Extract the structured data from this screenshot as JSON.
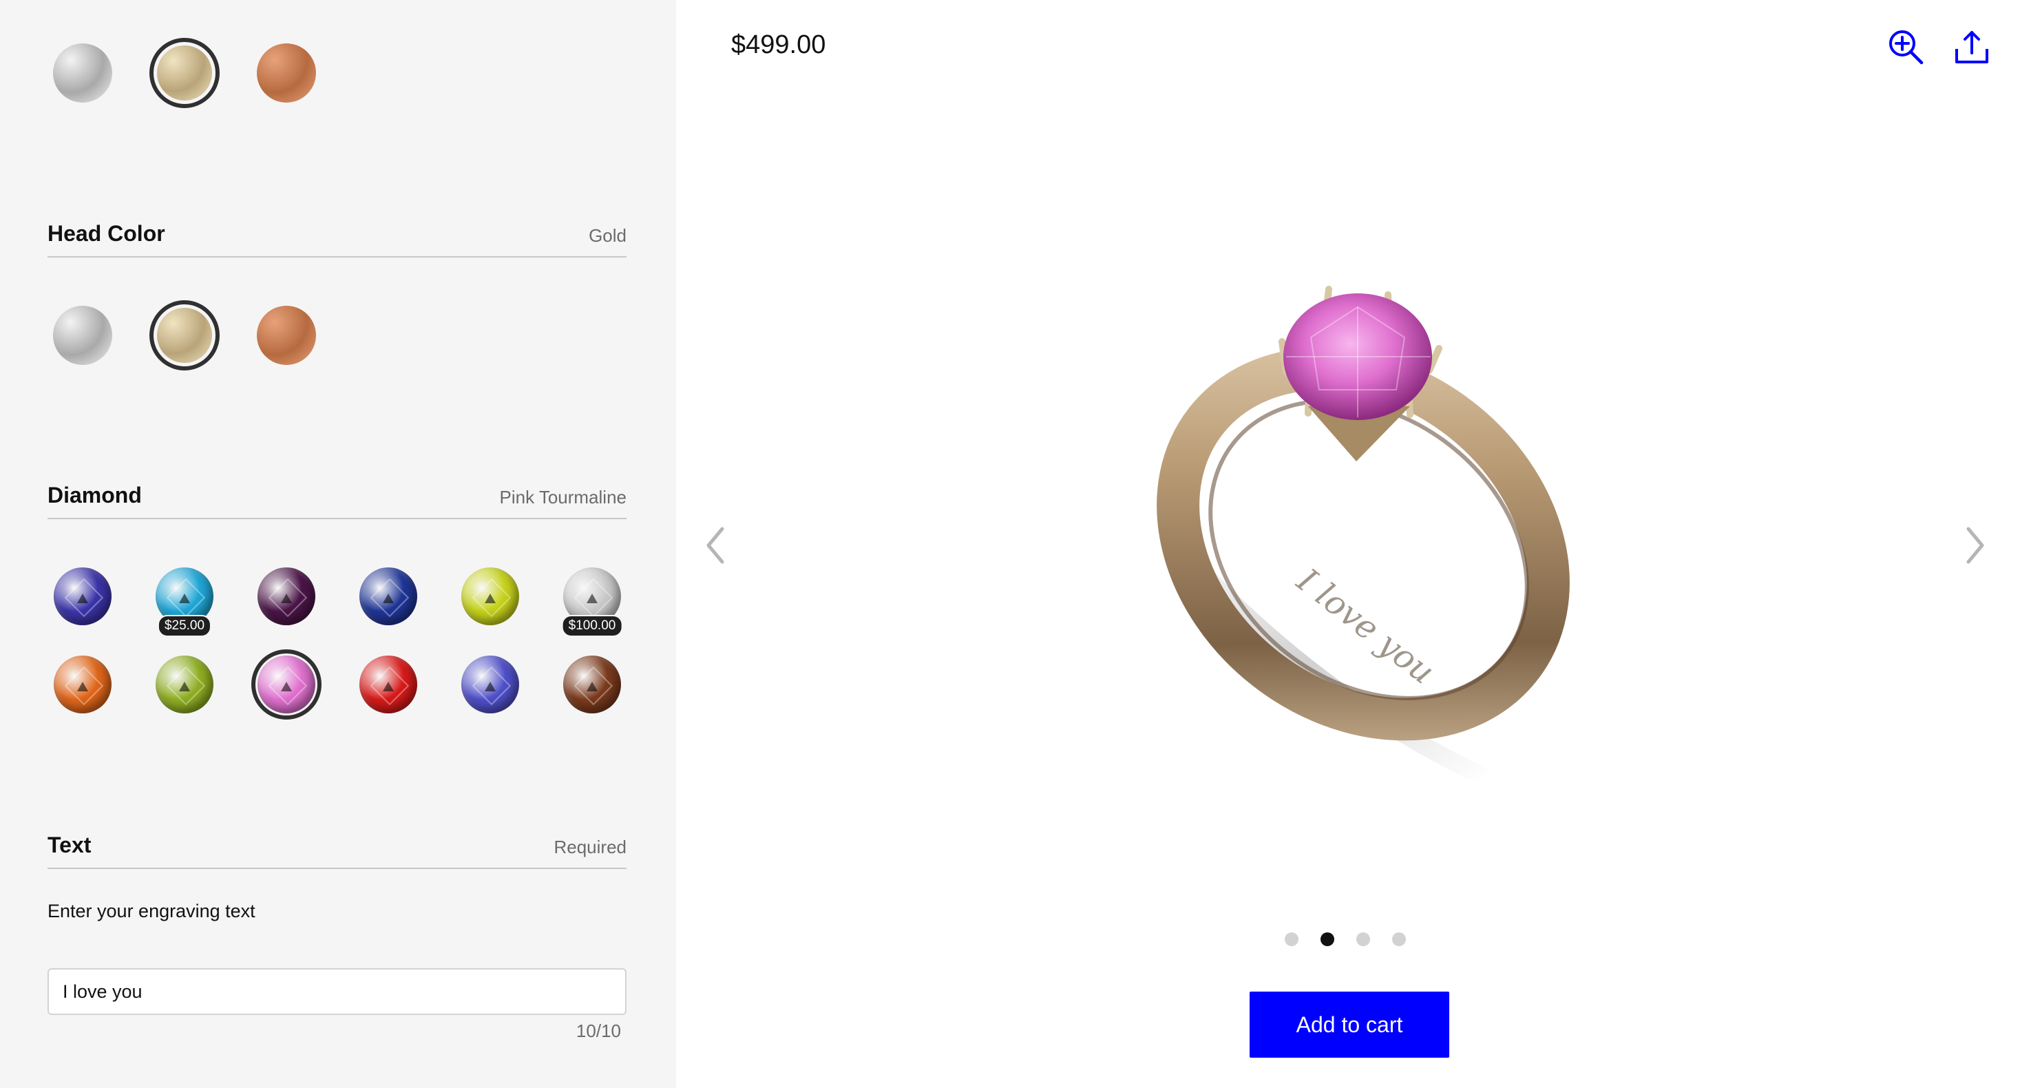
{
  "band_color": {
    "options": [
      {
        "name": "Silver",
        "color_a": "#f3f3f3",
        "color_b": "#a9a9a9"
      },
      {
        "name": "Gold",
        "color_a": "#f0e4c2",
        "color_b": "#b9a478"
      },
      {
        "name": "Rose Gold",
        "color_a": "#e7a27a",
        "color_b": "#b76a3f"
      }
    ],
    "selected_index": 1
  },
  "head_color": {
    "title": "Head Color",
    "value": "Gold",
    "options": [
      {
        "name": "Silver",
        "color_a": "#f3f3f3",
        "color_b": "#a9a9a9"
      },
      {
        "name": "Gold",
        "color_a": "#f0e4c2",
        "color_b": "#b9a478"
      },
      {
        "name": "Rose Gold",
        "color_a": "#e7a27a",
        "color_b": "#b76a3f"
      }
    ],
    "selected_index": 1
  },
  "diamond": {
    "title": "Diamond",
    "value": "Pink Tourmaline",
    "gems": [
      {
        "color": "#3b34a8",
        "price": ""
      },
      {
        "color": "#1fa6d6",
        "price": "$25.00"
      },
      {
        "color": "#4a1547",
        "price": ""
      },
      {
        "color": "#1f3596",
        "price": ""
      },
      {
        "color": "#c6d21a",
        "price": ""
      },
      {
        "color": "#c9c9c9",
        "price": "$100.00"
      },
      {
        "color": "#e0661a",
        "price": ""
      },
      {
        "color": "#8fae22",
        "price": ""
      },
      {
        "color": "#e070cf",
        "price": ""
      },
      {
        "color": "#d81a1a",
        "price": ""
      },
      {
        "color": "#4f4fc9",
        "price": ""
      },
      {
        "color": "#7a3a1d",
        "price": ""
      }
    ],
    "selected_index": 8
  },
  "text": {
    "title": "Text",
    "value": "Required",
    "label": "Enter your engraving text",
    "input_value": "I love you",
    "char_count": "10/10"
  },
  "product": {
    "price": "$499.00",
    "engraving": "I love you",
    "gem_color": "#e070cf",
    "metal_color": "#b89a74"
  },
  "carousel": {
    "count": 4,
    "active_index": 1
  },
  "actions": {
    "add_to_cart": "Add to cart"
  },
  "icons": [
    "zoom-in-icon",
    "share-icon",
    "chevron-left-icon",
    "chevron-right-icon"
  ],
  "accent_color": "#0000ff"
}
